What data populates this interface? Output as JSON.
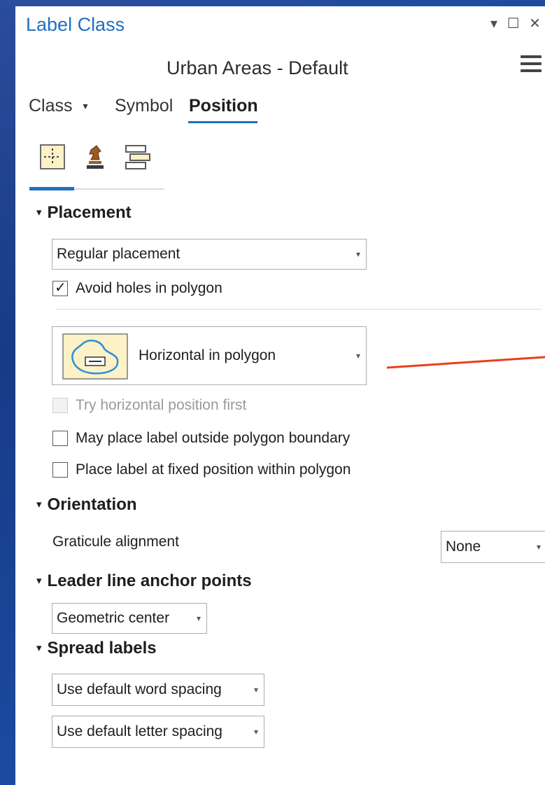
{
  "pane": {
    "title": "Label Class",
    "controls": {
      "dropdown": "▾",
      "maximize": "☐",
      "close": "✕"
    }
  },
  "class_name": "Urban Areas - Default",
  "tabs": {
    "class": "Class",
    "class_caret": "▾",
    "symbol": "Symbol",
    "position": "Position"
  },
  "subtabs": [
    "position-icon",
    "leader-icon",
    "stack-icon"
  ],
  "placement": {
    "header": "Placement",
    "dropdown_value": "Regular placement",
    "avoid_holes": {
      "label": "Avoid holes in polygon",
      "checked": true
    },
    "style_value": "Horizontal in polygon",
    "try_horizontal": {
      "label": "Try horizontal position first",
      "checked": false,
      "disabled": true
    },
    "outside_boundary": {
      "label": "May place label outside polygon boundary",
      "checked": false
    },
    "fixed_position": {
      "label": "Place label at fixed position within polygon",
      "checked": false
    }
  },
  "orientation": {
    "header": "Orientation",
    "graticule_label": "Graticule alignment",
    "graticule_value": "None"
  },
  "leader": {
    "header": "Leader line anchor points",
    "value": "Geometric center"
  },
  "spread": {
    "header": "Spread labels",
    "word_value": "Use default word spacing",
    "letter_value": "Use default letter spacing"
  },
  "glyphs": {
    "chevron": "▾",
    "check": "✓",
    "caret": "▾"
  },
  "colors": {
    "accent": "#1f6fbf",
    "annotation": "#e8401c",
    "frame": "#1a3f8c"
  }
}
